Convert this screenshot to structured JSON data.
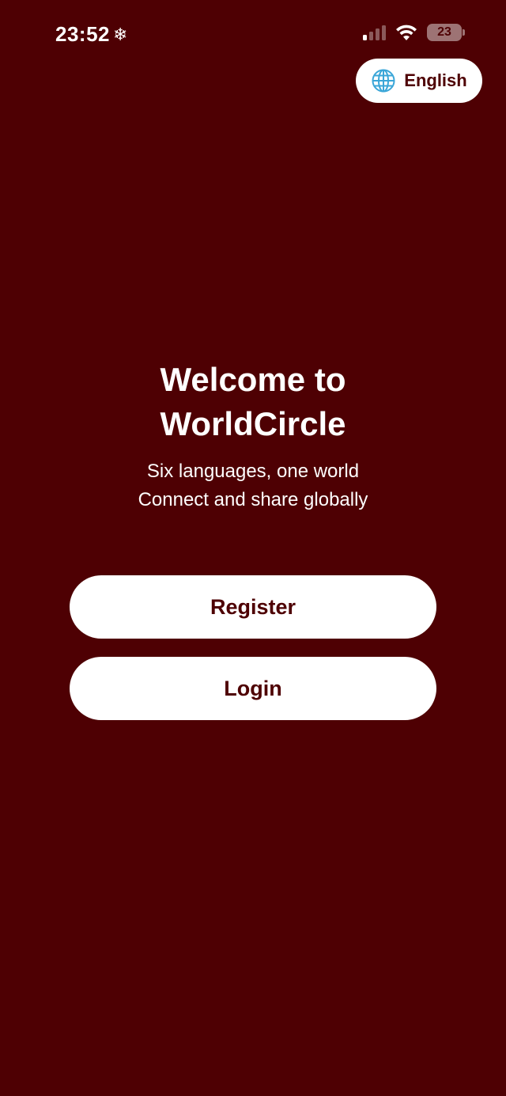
{
  "status_bar": {
    "time": "23:52",
    "focus_glyph": "❄",
    "battery_level": "23",
    "icons": [
      "signal-icon",
      "wifi-icon",
      "battery-icon"
    ]
  },
  "language_button": {
    "label": "English",
    "icon": "globe-icon"
  },
  "welcome": {
    "title_line1": "Welcome to",
    "title_line2": "WorldCircle",
    "subtitle_line1": "Six languages, one world",
    "subtitle_line2": "Connect and share globally"
  },
  "actions": {
    "register_label": "Register",
    "login_label": "Login"
  },
  "colors": {
    "background": "#4e0003",
    "button_bg": "#ffffff",
    "button_text": "#4e0003",
    "globe": "#3aa6d8"
  }
}
